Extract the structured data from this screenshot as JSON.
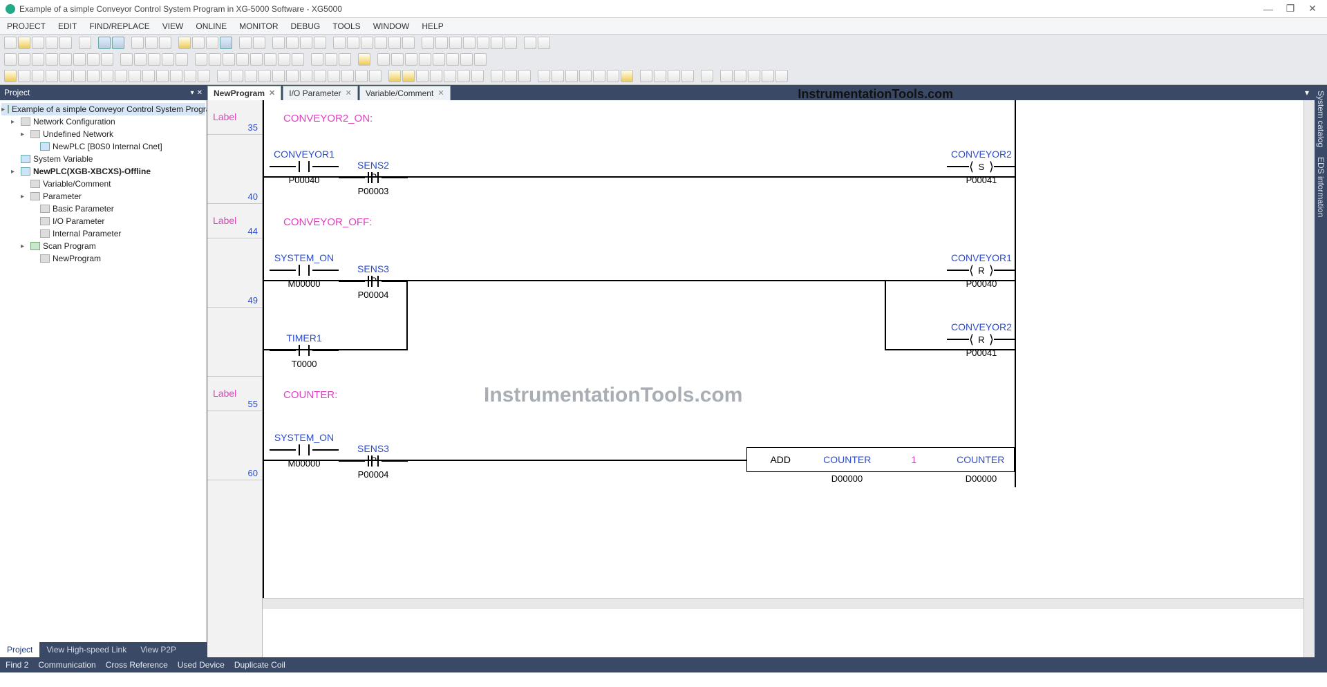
{
  "window": {
    "title": "Example of a simple Conveyor Control System Program in XG-5000 Software - XG5000"
  },
  "menu": [
    "PROJECT",
    "EDIT",
    "FIND/REPLACE",
    "VIEW",
    "ONLINE",
    "MONITOR",
    "DEBUG",
    "TOOLS",
    "WINDOW",
    "HELP"
  ],
  "projectPanel": {
    "header": "Project",
    "tabs": [
      "Project",
      "View High-speed Link",
      "View P2P"
    ],
    "tree": {
      "root": "Example of a simple Conveyor Control System Progra...",
      "networkCfg": "Network Configuration",
      "undefNet": "Undefined Network",
      "newPlcCnet": "NewPLC [B0S0 Internal Cnet]",
      "sysVar": "System Variable",
      "plc": "NewPLC(XGB-XBCXS)-Offline",
      "varcom": "Variable/Comment",
      "param": "Parameter",
      "basic": "Basic Parameter",
      "io": "I/O Parameter",
      "internal": "Internal Parameter",
      "scan": "Scan Program",
      "newprog": "NewProgram"
    }
  },
  "docTabs": [
    {
      "label": "NewProgram",
      "active": true
    },
    {
      "label": "I/O Parameter",
      "active": false
    },
    {
      "label": "Variable/Comment",
      "active": false
    }
  ],
  "watermark": "InstrumentationTools.com",
  "gutter": [
    {
      "label": "Label",
      "num": "35",
      "h": "50"
    },
    {
      "label": "",
      "num": "40",
      "h": "100"
    },
    {
      "label": "Label",
      "num": "44",
      "h": "50"
    },
    {
      "label": "",
      "num": "49",
      "h": "100"
    },
    {
      "label": "",
      "num": "",
      "h": "100"
    },
    {
      "label": "Label",
      "num": "55",
      "h": "50"
    },
    {
      "label": "",
      "num": "60",
      "h": "100"
    }
  ],
  "ladder": {
    "label1": "CONVEYOR2_ON:",
    "label2": "CONVEYOR_OFF:",
    "label3": "COUNTER:",
    "r1": {
      "c1": {
        "top": "CONVEYOR1",
        "bot": "P00040"
      },
      "c2": {
        "top": "SENS2",
        "bot": "P00003",
        "p": "P"
      },
      "coil": {
        "top": "CONVEYOR2",
        "letter": "S",
        "bot": "P00041"
      }
    },
    "r2": {
      "c1": {
        "top": "SYSTEM_ON",
        "bot": "M00000"
      },
      "c2": {
        "top": "SENS3",
        "bot": "P00004",
        "p": "P"
      },
      "coil": {
        "top": "CONVEYOR1",
        "letter": "R",
        "bot": "P00040"
      }
    },
    "r2b": {
      "c1": {
        "top": "TIMER1",
        "bot": "T0000"
      },
      "coil": {
        "top": "CONVEYOR2",
        "letter": "R",
        "bot": "P00041"
      }
    },
    "r3": {
      "c1": {
        "top": "SYSTEM_ON",
        "bot": "M00000"
      },
      "c2": {
        "top": "SENS3",
        "bot": "P00004",
        "p": "P"
      },
      "fn": {
        "op": "ADD",
        "a": "COUNTER",
        "aAddr": "D00000",
        "b": "1",
        "out": "COUNTER",
        "outAddr": "D00000"
      }
    }
  },
  "rightTabs": [
    "System catalog",
    "EDS information"
  ],
  "status": [
    "Find 2",
    "Communication",
    "Cross Reference",
    "Used Device",
    "Duplicate Coil"
  ]
}
